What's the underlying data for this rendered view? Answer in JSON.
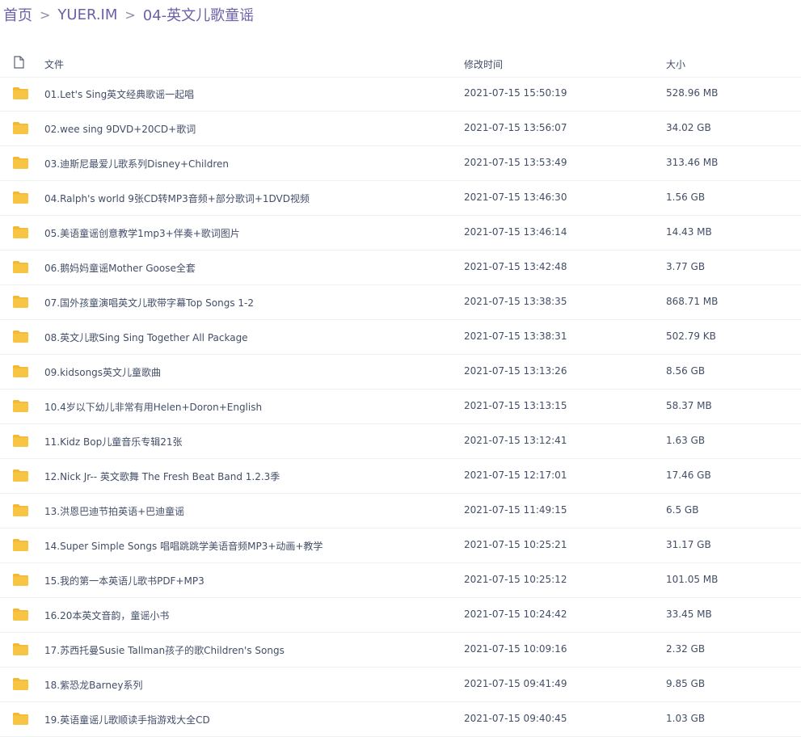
{
  "breadcrumb": {
    "items": [
      "首页",
      "YUER.IM",
      "04-英文儿歌童谣"
    ],
    "separator": ">"
  },
  "table": {
    "headers": {
      "name": "文件",
      "time": "修改时间",
      "size": "大小"
    },
    "rows": [
      {
        "name": "01.Let's Sing英文经典歌谣一起唱",
        "time": "2021-07-15 15:50:19",
        "size": "528.96 MB"
      },
      {
        "name": "02.wee sing 9DVD+20CD+歌词",
        "time": "2021-07-15 13:56:07",
        "size": "34.02 GB"
      },
      {
        "name": "03.迪斯尼最爱儿歌系列Disney+Children",
        "time": "2021-07-15 13:53:49",
        "size": "313.46 MB"
      },
      {
        "name": "04.Ralph's world 9张CD转MP3音频+部分歌词+1DVD视频",
        "time": "2021-07-15 13:46:30",
        "size": "1.56 GB"
      },
      {
        "name": "05.美语童谣创意教学1mp3+伴奏+歌词图片",
        "time": "2021-07-15 13:46:14",
        "size": "14.43 MB"
      },
      {
        "name": "06.鹅妈妈童谣Mother Goose全套",
        "time": "2021-07-15 13:42:48",
        "size": "3.77 GB"
      },
      {
        "name": "07.国外孩童演唱英文儿歌带字幕Top Songs 1-2",
        "time": "2021-07-15 13:38:35",
        "size": "868.71 MB"
      },
      {
        "name": "08.英文儿歌Sing Sing Together All Package",
        "time": "2021-07-15 13:38:31",
        "size": "502.79 KB"
      },
      {
        "name": "09.kidsongs英文儿童歌曲",
        "time": "2021-07-15 13:13:26",
        "size": "8.56 GB"
      },
      {
        "name": "10.4岁以下幼儿非常有用Helen+Doron+English",
        "time": "2021-07-15 13:13:15",
        "size": "58.37 MB"
      },
      {
        "name": "11.Kidz Bop儿童音乐专辑21张",
        "time": "2021-07-15 13:12:41",
        "size": "1.63 GB"
      },
      {
        "name": "12.Nick Jr-- 英文歌舞 The Fresh Beat Band 1.2.3季",
        "time": "2021-07-15 12:17:01",
        "size": "17.46 GB"
      },
      {
        "name": "13.洪恩巴迪节拍英语+巴迪童谣",
        "time": "2021-07-15 11:49:15",
        "size": "6.5 GB"
      },
      {
        "name": "14.Super Simple Songs 唱唱跳跳学美语音频MP3+动画+教学",
        "time": "2021-07-15 10:25:21",
        "size": "31.17 GB"
      },
      {
        "name": "15.我的第一本英语儿歌书PDF+MP3",
        "time": "2021-07-15 10:25:12",
        "size": "101.05 MB"
      },
      {
        "name": "16.20本英文音韵，童谣小书",
        "time": "2021-07-15 10:24:42",
        "size": "33.45 MB"
      },
      {
        "name": "17.苏西托曼Susie Tallman孩子的歌Children's Songs",
        "time": "2021-07-15 10:09:16",
        "size": "2.32 GB"
      },
      {
        "name": "18.紫恐龙Barney系列",
        "time": "2021-07-15 09:41:49",
        "size": "9.85 GB"
      },
      {
        "name": "19.英语童谣儿歌顺读手指游戏大全CD",
        "time": "2021-07-15 09:40:45",
        "size": "1.03 GB"
      }
    ]
  },
  "colors": {
    "folder": "#f7c443",
    "folder_tab": "#f3b936",
    "text": "#424e67",
    "link": "#6d5fa8",
    "divider": "#eef0f4"
  }
}
